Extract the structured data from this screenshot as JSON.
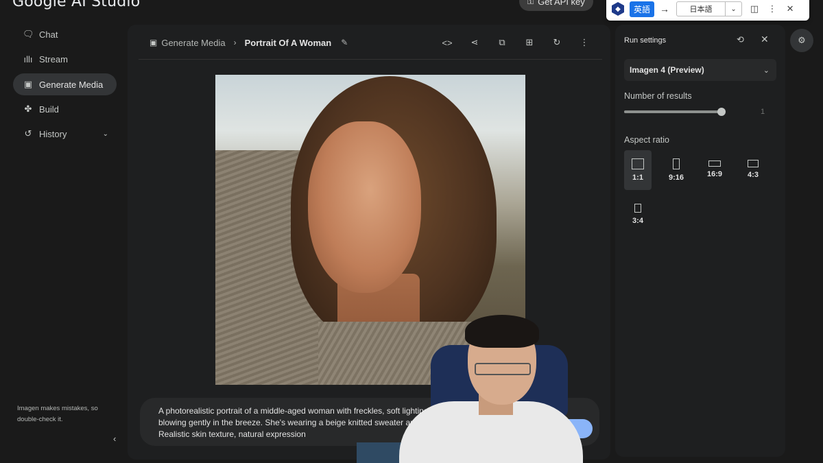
{
  "app": {
    "logo": "Google AI Studio",
    "api_key_label": "Get API key",
    "api_key_icon": "key-icon"
  },
  "translator": {
    "source_lang": "英語",
    "target_lang": "日本語",
    "arrow": "→"
  },
  "sidebar": {
    "items": [
      {
        "label": "Chat",
        "icon": "chat-icon"
      },
      {
        "label": "Stream",
        "icon": "waveform-icon"
      },
      {
        "label": "Generate Media",
        "icon": "image-icon",
        "active": true
      },
      {
        "label": "Build",
        "icon": "puzzle-icon"
      },
      {
        "label": "History",
        "icon": "history-icon",
        "expandable": true
      }
    ],
    "disclaimer": "Imagen makes mistakes, so double-check it."
  },
  "main": {
    "breadcrumb_parent": "Generate Media",
    "breadcrumb_title": "Portrait Of A Woman",
    "toolbar_icons": [
      "code-icon",
      "share-icon",
      "compare-icon",
      "grid-icon",
      "refresh-icon",
      "more-icon"
    ],
    "prompt": "A photorealistic portrait of a middle-aged woman with freckles, soft lighting, a... blowing gently in the breeze. She's wearing a beige knitted sweater and... Realistic skin texture, natural expression",
    "prompt_line1": "A photorealistic portrait of a middle-aged woman with freckles, soft lighting, a",
    "prompt_line2": "blowing gently in the breeze. She's wearing a beige knitted sweater and",
    "prompt_line3": "Realistic skin texture, natural expression",
    "run_icon": "↵"
  },
  "settings": {
    "title": "Run settings",
    "model": "Imagen 4 (Preview)",
    "num_results_label": "Number of results",
    "num_results_value": "1",
    "num_results_fraction": 1.0,
    "aspect_ratio_label": "Aspect ratio",
    "aspect_ratios": [
      "1:1",
      "9:16",
      "16:9",
      "4:3",
      "3:4"
    ],
    "selected_aspect_ratio": "1:1"
  },
  "colors": {
    "accent": "#8ab4f8",
    "background": "#1a1a1a",
    "panel": "#1e1f20",
    "translator_source": "#1a73e8"
  }
}
